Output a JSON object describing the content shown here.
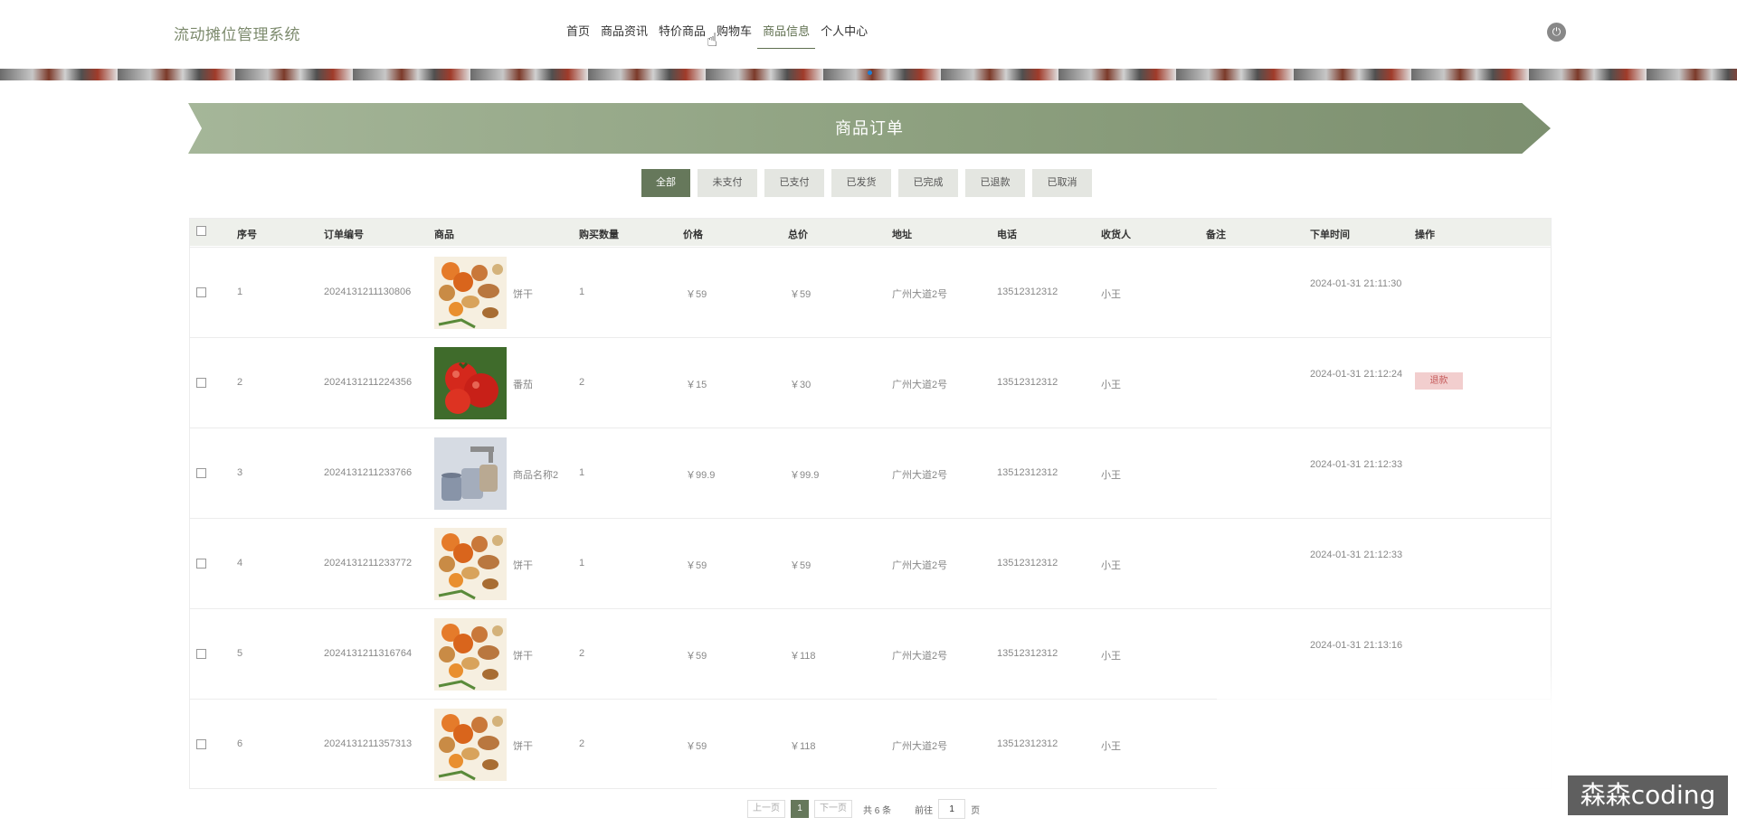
{
  "header": {
    "brand": "流动摊位管理系统",
    "nav": [
      "首页",
      "商品资讯",
      "特价商品",
      "购物车",
      "商品信息",
      "个人中心"
    ],
    "active_nav": "商品信息",
    "power_icon": "power-icon"
  },
  "page": {
    "title": "商品订单"
  },
  "tabs": [
    "全部",
    "未支付",
    "已支付",
    "已发货",
    "已完成",
    "已退款",
    "已取消"
  ],
  "active_tab": "全部",
  "table": {
    "columns": [
      "序号",
      "订单编号",
      "商品",
      "购买数量",
      "价格",
      "总价",
      "地址",
      "电话",
      "收货人",
      "备注",
      "下单时间",
      "操作"
    ],
    "rows": [
      {
        "index": "1",
        "order_no": "2024131211130806",
        "product": "饼干",
        "qty": "1",
        "price": "￥59",
        "total": "￥59",
        "address": "广州大道2号",
        "phone": "13512312312",
        "receiver": "小王",
        "note": "",
        "time": "2024-01-31 21:11:30",
        "action": "",
        "image": "snacks"
      },
      {
        "index": "2",
        "order_no": "2024131211224356",
        "product": "番茄",
        "qty": "2",
        "price": "￥15",
        "total": "￥30",
        "address": "广州大道2号",
        "phone": "13512312312",
        "receiver": "小王",
        "note": "",
        "time": "2024-01-31 21:12:24",
        "action": "退款",
        "image": "tomato"
      },
      {
        "index": "3",
        "order_no": "2024131211233766",
        "product": "商品名称2",
        "qty": "1",
        "price": "￥99.9",
        "total": "￥99.9",
        "address": "广州大道2号",
        "phone": "13512312312",
        "receiver": "小王",
        "note": "",
        "time": "2024-01-31 21:12:33",
        "action": "",
        "image": "cups"
      },
      {
        "index": "4",
        "order_no": "2024131211233772",
        "product": "饼干",
        "qty": "1",
        "price": "￥59",
        "total": "￥59",
        "address": "广州大道2号",
        "phone": "13512312312",
        "receiver": "小王",
        "note": "",
        "time": "2024-01-31 21:12:33",
        "action": "",
        "image": "snacks"
      },
      {
        "index": "5",
        "order_no": "2024131211316764",
        "product": "饼干",
        "qty": "2",
        "price": "￥59",
        "total": "￥118",
        "address": "广州大道2号",
        "phone": "13512312312",
        "receiver": "小王",
        "note": "",
        "time": "2024-01-31 21:13:16",
        "action": "",
        "image": "snacks"
      },
      {
        "index": "6",
        "order_no": "2024131211357313",
        "product": "饼干",
        "qty": "2",
        "price": "￥59",
        "total": "￥118",
        "address": "广州大道2号",
        "phone": "13512312312",
        "receiver": "小王",
        "note": "",
        "time": "",
        "action": "",
        "image": "snacks"
      }
    ]
  },
  "pagination": {
    "prev": "上一页",
    "current": "1",
    "next": "下一页",
    "total": "共 6 条",
    "goto_label": "前往",
    "goto_value": "1",
    "page_suffix": "页"
  },
  "watermark": "森森coding",
  "colors": {
    "accent": "#66785b",
    "ribbon": "#8da07f",
    "refund_bg": "#f2cece"
  }
}
